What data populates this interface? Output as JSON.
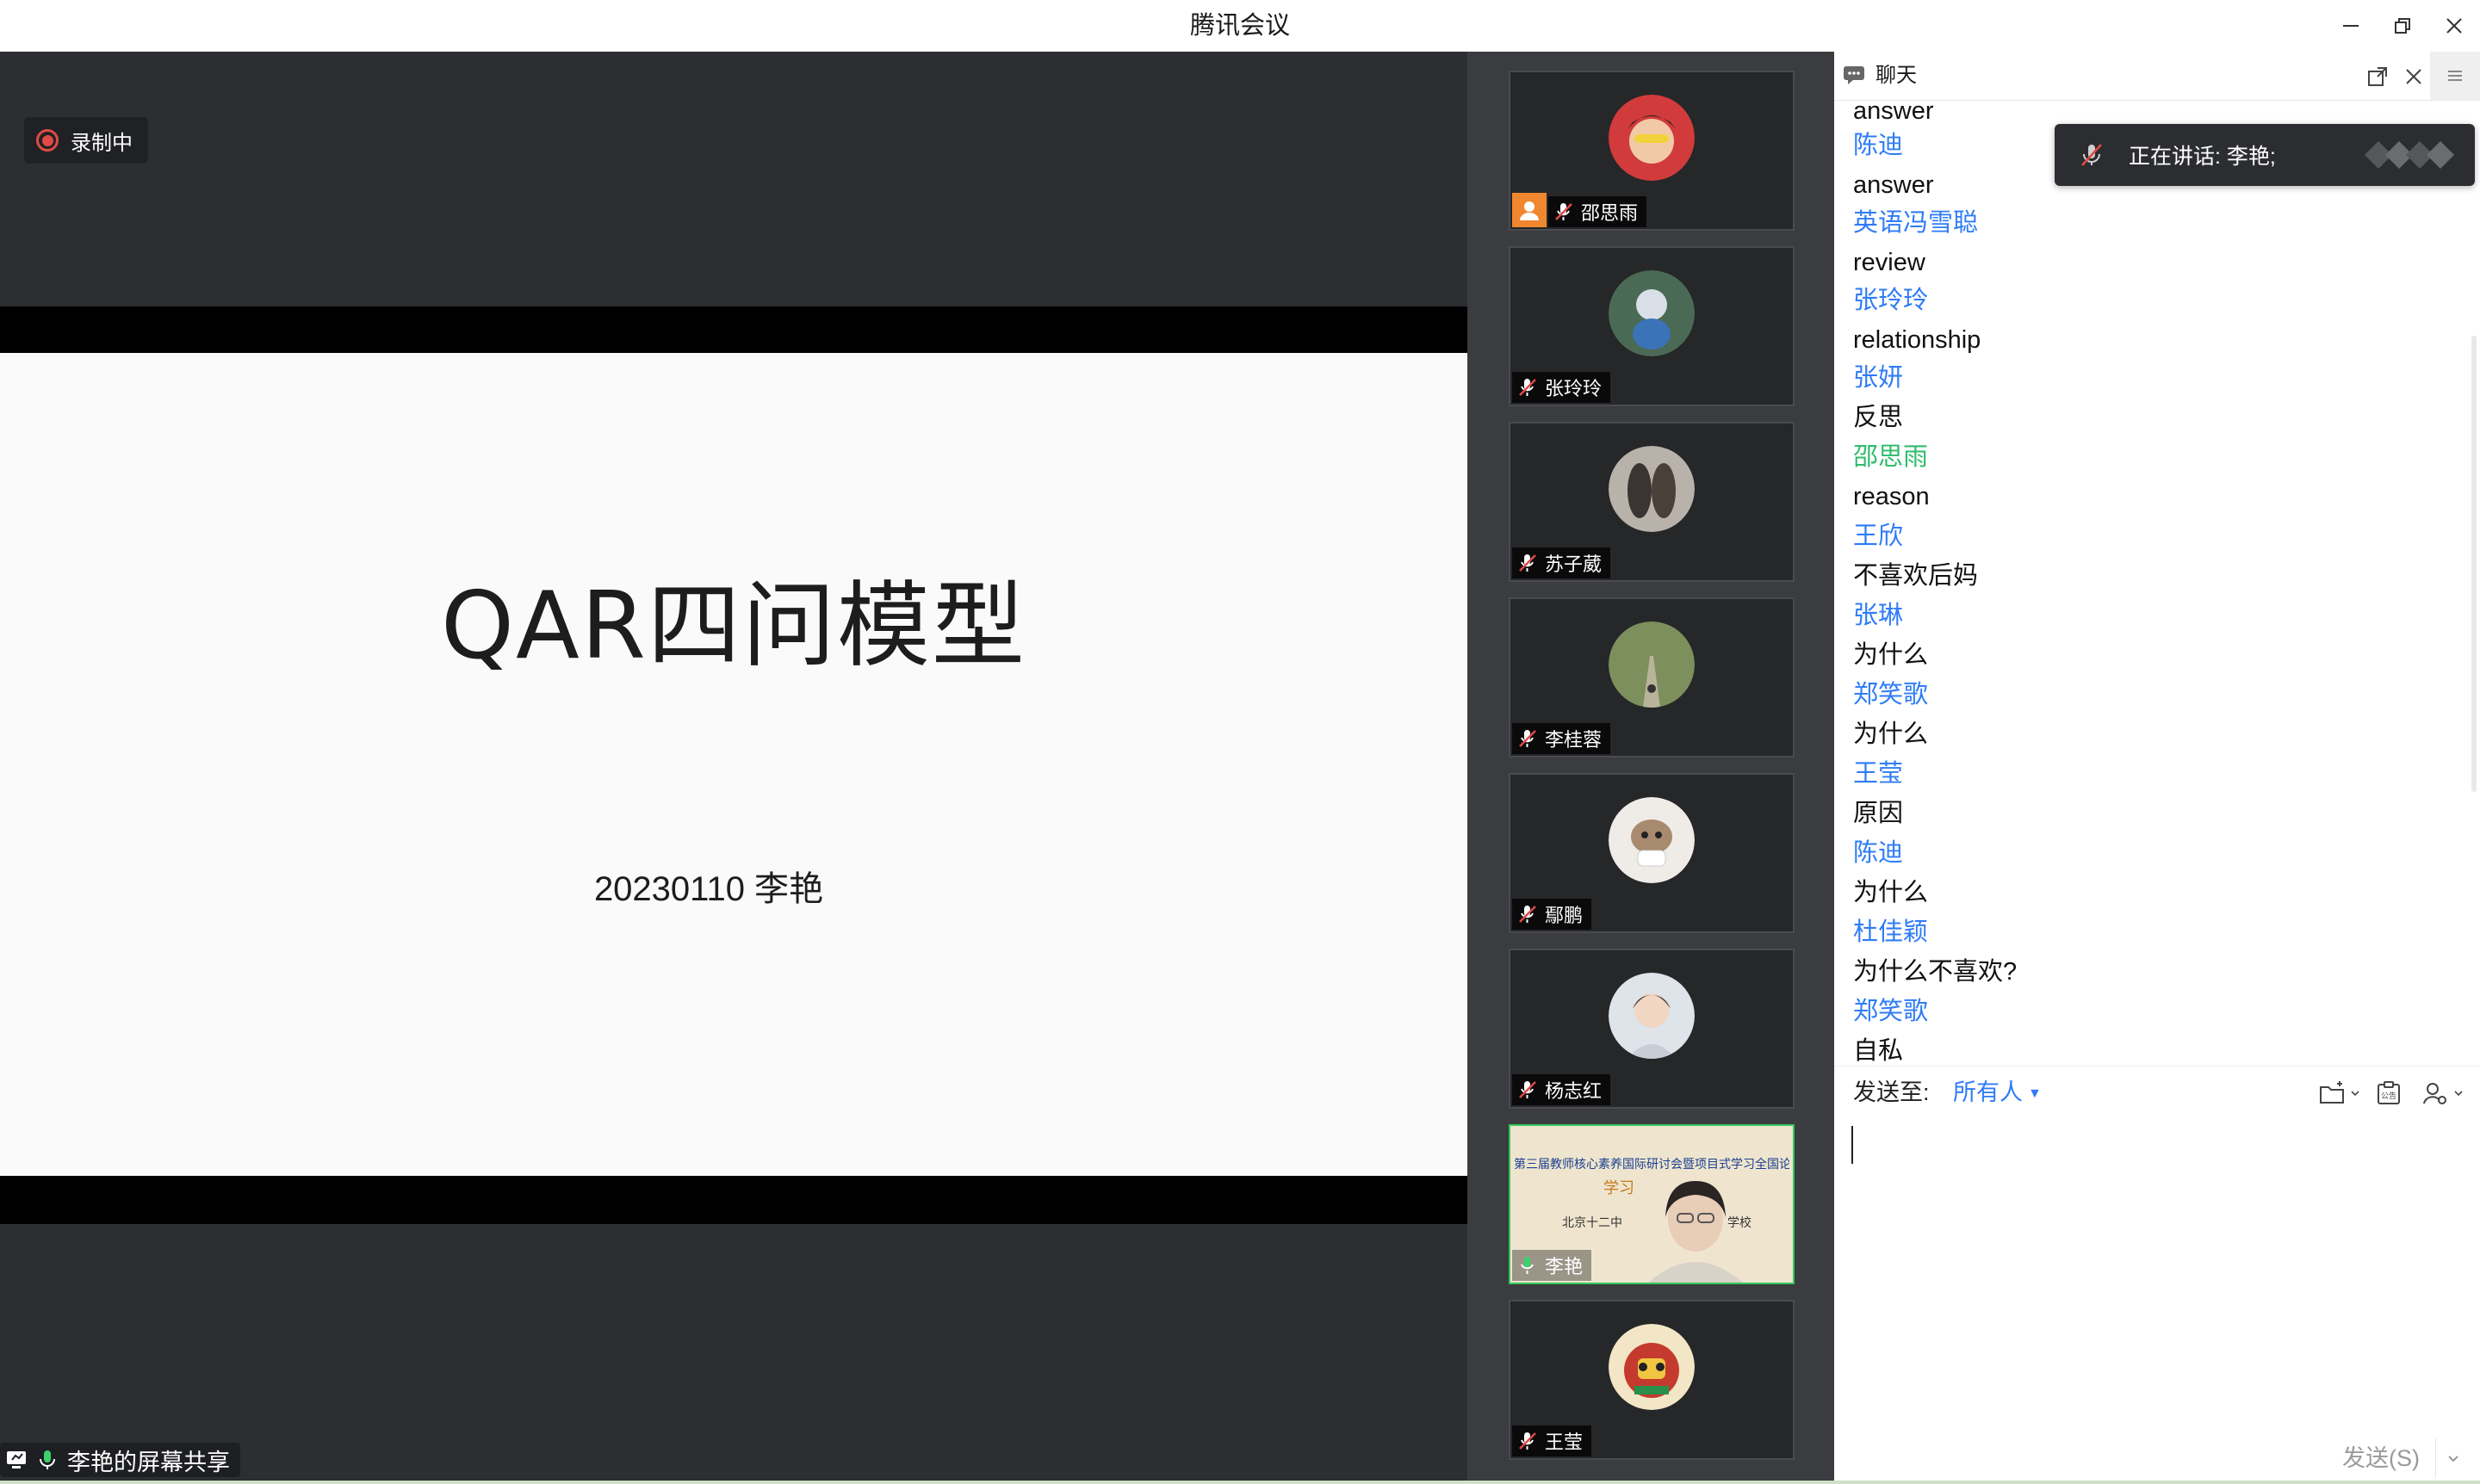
{
  "app": {
    "title": "腾讯会议",
    "recording_label": "录制中",
    "share_label": "李艳的屏幕共享"
  },
  "slide": {
    "title": "QAR四问模型",
    "subtitle": "20230110  李艳"
  },
  "participants": [
    {
      "name": "邵思雨",
      "host": true,
      "mic": "muted",
      "avatar_color": "#d13b3b"
    },
    {
      "name": "张玲玲",
      "host": false,
      "mic": "muted",
      "avatar_color": "#4a6a55"
    },
    {
      "name": "苏子葳",
      "host": false,
      "mic": "muted",
      "avatar_color": "#8a7f78"
    },
    {
      "name": "李桂蓉",
      "host": false,
      "mic": "muted",
      "avatar_color": "#7d8f5c"
    },
    {
      "name": "鄢鹏",
      "host": false,
      "mic": "muted",
      "avatar_color": "#e8e2dc"
    },
    {
      "name": "杨志红",
      "host": false,
      "mic": "muted",
      "avatar_color": "#c9ccd6"
    },
    {
      "name": "李艳",
      "host": false,
      "mic": "active",
      "video": true,
      "banner_text": "第三届教师核心素养国际研讨会暨项目式学习全国论坛",
      "banner_line2": "学习",
      "banner_line3": "北京十二中",
      "banner_line4": "学校",
      "avatar_color": "#efe5cf"
    },
    {
      "name": "王莹",
      "host": false,
      "mic": "muted",
      "avatar_color": "#c53a2e"
    }
  ],
  "chat": {
    "title": "聊天",
    "messages": [
      {
        "sender": "",
        "text": "answer"
      },
      {
        "sender": "陈迪",
        "text": "answer"
      },
      {
        "sender": "英语冯雪聪",
        "text": "review"
      },
      {
        "sender": "张玲玲",
        "text": "relationship"
      },
      {
        "sender": "张妍",
        "text": "反思"
      },
      {
        "sender": "邵思雨",
        "text": "reason",
        "host": true
      },
      {
        "sender": "王欣",
        "text": "不喜欢后妈"
      },
      {
        "sender": "张琳",
        "text": "为什么"
      },
      {
        "sender": "郑笑歌",
        "text": "为什么"
      },
      {
        "sender": "王莹",
        "text": "原因"
      },
      {
        "sender": "陈迪",
        "text": "为什么"
      },
      {
        "sender": "杜佳颖",
        "text": "为什么不喜欢?"
      },
      {
        "sender": "郑笑歌",
        "text": "自私"
      }
    ],
    "send_to_label": "发送至:",
    "recipient": "所有人",
    "send_button": "发送(S)",
    "speaking_text": "正在讲话: 李艳;"
  },
  "colors": {
    "sender_blue": "#2f7cf6",
    "host_green": "#2fbb6b",
    "recording_red": "#e04a45",
    "host_orange": "#f0872f",
    "active_border": "#34c759"
  }
}
